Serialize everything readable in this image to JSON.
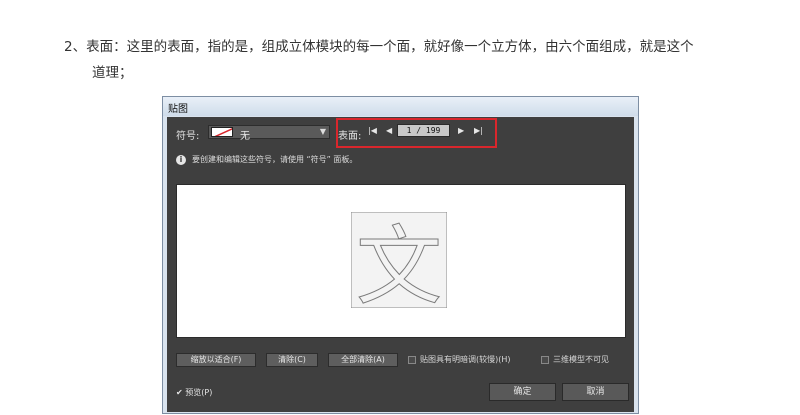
{
  "article": {
    "line1": "2、表面：这里的表面，指的是，组成立体模块的每一个面，就好像一个立方体，由六个面组成，就是这个",
    "line2": "道理；"
  },
  "dialog": {
    "title": "贴图",
    "symbol_label": "符号:",
    "symbol_value": "无",
    "surface_label": "表面:",
    "page_value": "1 / 199",
    "info_text": "要创建和编辑这些符号，请使用 “符号” 面板。",
    "preview_glyph": "文",
    "buttons": {
      "shrink_fit": "缩放以适合(F)",
      "clear": "清除(C)",
      "clear_all": "全部清除(A)"
    },
    "checkboxes": {
      "shade_artwork": "贴图具有明暗调(较慢)(H)",
      "invisible_geometry": "三维模型不可见"
    },
    "preview_label": "预览(P)",
    "ok": "确定",
    "cancel": "取消"
  },
  "colors": {
    "dialog_bg": "#3f3f3f",
    "highlight": "#d9262c"
  }
}
